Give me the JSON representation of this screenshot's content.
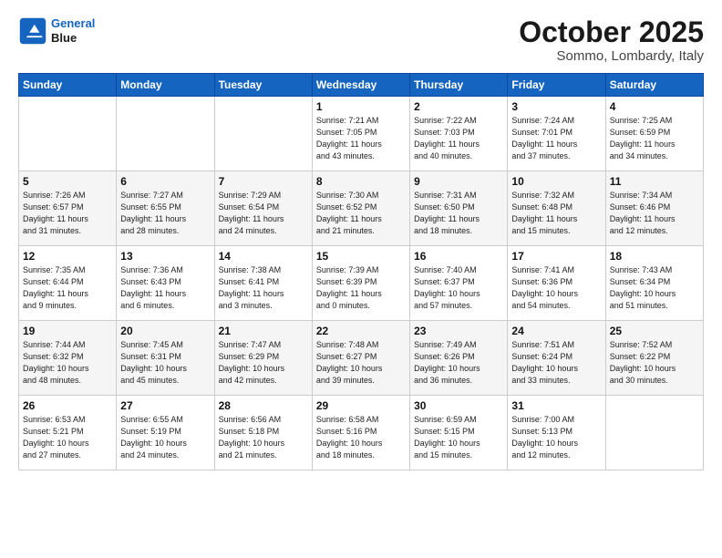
{
  "logo": {
    "line1": "General",
    "line2": "Blue"
  },
  "header": {
    "month": "October 2025",
    "location": "Sommo, Lombardy, Italy"
  },
  "weekdays": [
    "Sunday",
    "Monday",
    "Tuesday",
    "Wednesday",
    "Thursday",
    "Friday",
    "Saturday"
  ],
  "weeks": [
    [
      {
        "day": "",
        "info": ""
      },
      {
        "day": "",
        "info": ""
      },
      {
        "day": "",
        "info": ""
      },
      {
        "day": "1",
        "info": "Sunrise: 7:21 AM\nSunset: 7:05 PM\nDaylight: 11 hours\nand 43 minutes."
      },
      {
        "day": "2",
        "info": "Sunrise: 7:22 AM\nSunset: 7:03 PM\nDaylight: 11 hours\nand 40 minutes."
      },
      {
        "day": "3",
        "info": "Sunrise: 7:24 AM\nSunset: 7:01 PM\nDaylight: 11 hours\nand 37 minutes."
      },
      {
        "day": "4",
        "info": "Sunrise: 7:25 AM\nSunset: 6:59 PM\nDaylight: 11 hours\nand 34 minutes."
      }
    ],
    [
      {
        "day": "5",
        "info": "Sunrise: 7:26 AM\nSunset: 6:57 PM\nDaylight: 11 hours\nand 31 minutes."
      },
      {
        "day": "6",
        "info": "Sunrise: 7:27 AM\nSunset: 6:55 PM\nDaylight: 11 hours\nand 28 minutes."
      },
      {
        "day": "7",
        "info": "Sunrise: 7:29 AM\nSunset: 6:54 PM\nDaylight: 11 hours\nand 24 minutes."
      },
      {
        "day": "8",
        "info": "Sunrise: 7:30 AM\nSunset: 6:52 PM\nDaylight: 11 hours\nand 21 minutes."
      },
      {
        "day": "9",
        "info": "Sunrise: 7:31 AM\nSunset: 6:50 PM\nDaylight: 11 hours\nand 18 minutes."
      },
      {
        "day": "10",
        "info": "Sunrise: 7:32 AM\nSunset: 6:48 PM\nDaylight: 11 hours\nand 15 minutes."
      },
      {
        "day": "11",
        "info": "Sunrise: 7:34 AM\nSunset: 6:46 PM\nDaylight: 11 hours\nand 12 minutes."
      }
    ],
    [
      {
        "day": "12",
        "info": "Sunrise: 7:35 AM\nSunset: 6:44 PM\nDaylight: 11 hours\nand 9 minutes."
      },
      {
        "day": "13",
        "info": "Sunrise: 7:36 AM\nSunset: 6:43 PM\nDaylight: 11 hours\nand 6 minutes."
      },
      {
        "day": "14",
        "info": "Sunrise: 7:38 AM\nSunset: 6:41 PM\nDaylight: 11 hours\nand 3 minutes."
      },
      {
        "day": "15",
        "info": "Sunrise: 7:39 AM\nSunset: 6:39 PM\nDaylight: 11 hours\nand 0 minutes."
      },
      {
        "day": "16",
        "info": "Sunrise: 7:40 AM\nSunset: 6:37 PM\nDaylight: 10 hours\nand 57 minutes."
      },
      {
        "day": "17",
        "info": "Sunrise: 7:41 AM\nSunset: 6:36 PM\nDaylight: 10 hours\nand 54 minutes."
      },
      {
        "day": "18",
        "info": "Sunrise: 7:43 AM\nSunset: 6:34 PM\nDaylight: 10 hours\nand 51 minutes."
      }
    ],
    [
      {
        "day": "19",
        "info": "Sunrise: 7:44 AM\nSunset: 6:32 PM\nDaylight: 10 hours\nand 48 minutes."
      },
      {
        "day": "20",
        "info": "Sunrise: 7:45 AM\nSunset: 6:31 PM\nDaylight: 10 hours\nand 45 minutes."
      },
      {
        "day": "21",
        "info": "Sunrise: 7:47 AM\nSunset: 6:29 PM\nDaylight: 10 hours\nand 42 minutes."
      },
      {
        "day": "22",
        "info": "Sunrise: 7:48 AM\nSunset: 6:27 PM\nDaylight: 10 hours\nand 39 minutes."
      },
      {
        "day": "23",
        "info": "Sunrise: 7:49 AM\nSunset: 6:26 PM\nDaylight: 10 hours\nand 36 minutes."
      },
      {
        "day": "24",
        "info": "Sunrise: 7:51 AM\nSunset: 6:24 PM\nDaylight: 10 hours\nand 33 minutes."
      },
      {
        "day": "25",
        "info": "Sunrise: 7:52 AM\nSunset: 6:22 PM\nDaylight: 10 hours\nand 30 minutes."
      }
    ],
    [
      {
        "day": "26",
        "info": "Sunrise: 6:53 AM\nSunset: 5:21 PM\nDaylight: 10 hours\nand 27 minutes."
      },
      {
        "day": "27",
        "info": "Sunrise: 6:55 AM\nSunset: 5:19 PM\nDaylight: 10 hours\nand 24 minutes."
      },
      {
        "day": "28",
        "info": "Sunrise: 6:56 AM\nSunset: 5:18 PM\nDaylight: 10 hours\nand 21 minutes."
      },
      {
        "day": "29",
        "info": "Sunrise: 6:58 AM\nSunset: 5:16 PM\nDaylight: 10 hours\nand 18 minutes."
      },
      {
        "day": "30",
        "info": "Sunrise: 6:59 AM\nSunset: 5:15 PM\nDaylight: 10 hours\nand 15 minutes."
      },
      {
        "day": "31",
        "info": "Sunrise: 7:00 AM\nSunset: 5:13 PM\nDaylight: 10 hours\nand 12 minutes."
      },
      {
        "day": "",
        "info": ""
      }
    ]
  ]
}
